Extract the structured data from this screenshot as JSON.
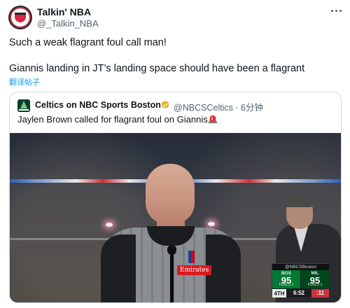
{
  "author": {
    "display_name": "Talkin' NBA",
    "handle": "@_Talkin_NBA"
  },
  "tweet": {
    "line1": "Such a weak flagrant foul call man!",
    "line2": "Giannis landing in JT’s landing space should have been a flagrant",
    "translate_label": "翻译帖子"
  },
  "quoted": {
    "display_name": "Celtics on NBC Sports Boston",
    "handle_time": "@NBCSCeltics · 6分钟",
    "text": "Jaylen Brown called for flagrant foul on Giannis",
    "verified_color": "#e8b325"
  },
  "video": {
    "sponsor_patch": "Emirates",
    "scorebug": {
      "network": "@NBCSBoston",
      "home": {
        "abbr": "BOS",
        "points": "95",
        "fouls": "FOULS 3"
      },
      "away": {
        "abbr": "MIL",
        "points": "95",
        "fouls": "FOULS 1"
      },
      "period": "4TH",
      "clock": "6:52",
      "shot_clock": ":11"
    }
  },
  "icons": {
    "more": "more-horizontal-icon",
    "verified": "verified-badge-icon",
    "siren": "siren-emoji-icon"
  },
  "colors": {
    "link": "#1d9bf0",
    "text": "#0f1419",
    "muted": "#536471",
    "celtics_green": "#007a33",
    "bucks_green": "#00471b"
  }
}
